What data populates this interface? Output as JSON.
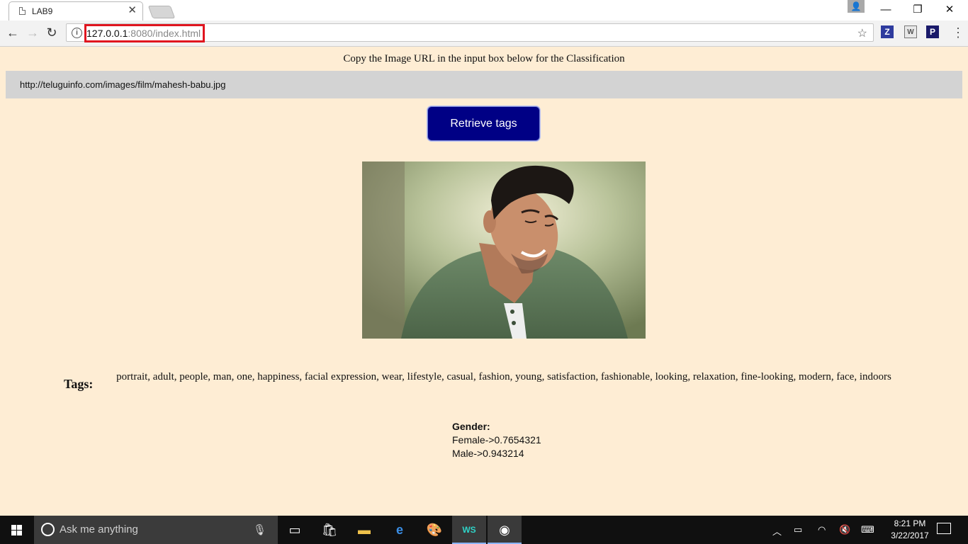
{
  "browser": {
    "tab_title": "LAB9",
    "url_host": "127.0.0.1",
    "url_rest": ":8080/index.html"
  },
  "page": {
    "instructions": "Copy the Image URL in the input box below for the Classification",
    "image_url_value": "http://teluguinfo.com/images/film/mahesh-babu.jpg",
    "retrieve_button": "Retrieve tags",
    "tags_label": "Tags:",
    "tags": "portrait, adult, people, man, one, happiness, facial expression, wear, lifestyle, casual, fashion, young, satisfaction, fashionable, looking, relaxation, fine-looking, modern, face, indoors",
    "gender_title": "Gender:",
    "female_score": "Female->0.7654321",
    "male_score": "Male->0.943214"
  },
  "taskbar": {
    "search_placeholder": "Ask me anything",
    "time": "8:21 PM",
    "date": "3/22/2017"
  },
  "colors": {
    "page_background": "#feedd4",
    "input_background": "#d3d3d3",
    "button_background": "#000085",
    "url_highlight": "#e0151f"
  }
}
